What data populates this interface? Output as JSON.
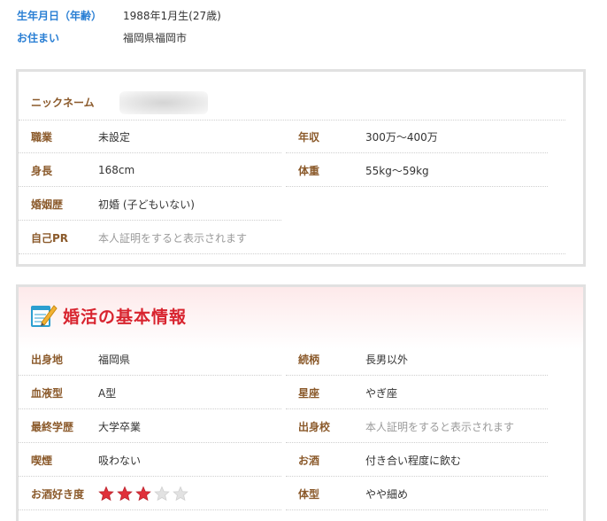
{
  "top_info": {
    "birthdate_label": "生年月日（年齢）",
    "birthdate_value": "1988年1月生(27歳)",
    "residence_label": "お住まい",
    "residence_value": "福岡県福岡市"
  },
  "profile": {
    "nickname_label": "ニックネーム",
    "occupation_label": "職業",
    "occupation_value": "未設定",
    "income_label": "年収",
    "income_value": "300万～400万",
    "height_label": "身長",
    "height_value": "168cm",
    "weight_label": "体重",
    "weight_value": "55kg～59kg",
    "marriage_label": "婚姻歴",
    "marriage_value": "初婚 (子どもいない)",
    "pr_label": "自己PR",
    "pr_value": "本人証明をすると表示されます"
  },
  "konkatsu": {
    "title": "婚活の基本情報",
    "icon": "memo-pencil-icon",
    "birthplace_label": "出身地",
    "birthplace_value": "福岡県",
    "sibling_label": "続柄",
    "sibling_value": "長男以外",
    "blood_label": "血液型",
    "blood_value": "A型",
    "zodiac_label": "星座",
    "zodiac_value": "やぎ座",
    "education_label": "最終学歴",
    "education_value": "大学卒業",
    "school_label": "出身校",
    "school_value": "本人証明をすると表示されます",
    "smoking_label": "喫煙",
    "smoking_value": "吸わない",
    "drinking_label": "お酒",
    "drinking_value": "付き合い程度に飲む",
    "drink_pref_label": "お酒好き度",
    "drink_pref_rating": 3,
    "drink_pref_max": 5,
    "body_label": "体型",
    "body_value": "やや細め"
  },
  "colors": {
    "top_label": "#2a7fd4",
    "field_label": "#8b5a2b",
    "section_title": "#d8242f",
    "star_filled": "#e0303a",
    "star_empty": "#e2e2e2"
  }
}
